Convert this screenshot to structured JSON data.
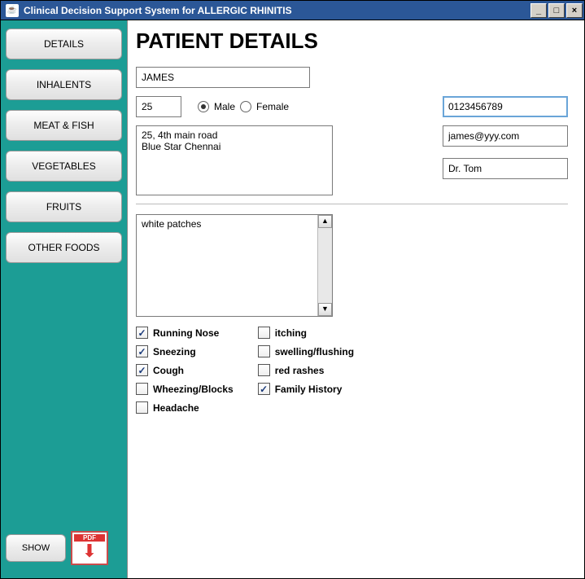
{
  "window": {
    "title": "Clinical Decision Support System for ALLERGIC RHINITIS"
  },
  "sidebar": {
    "items": [
      {
        "label": "DETAILS"
      },
      {
        "label": "INHALENTS"
      },
      {
        "label": "MEAT & FISH"
      },
      {
        "label": "VEGETABLES"
      },
      {
        "label": "FRUITS"
      },
      {
        "label": "OTHER FOODS"
      }
    ],
    "show_label": "SHOW",
    "pdf_label": "PDF"
  },
  "main": {
    "heading": "PATIENT DETAILS",
    "name": "JAMES",
    "age": "25",
    "gender": {
      "male_label": "Male",
      "female_label": "Female",
      "selected": "male"
    },
    "phone": "0123456789",
    "email": "james@yyy.com",
    "doctor": "Dr. Tom",
    "address": "25, 4th main road\nBlue Star Chennai",
    "notes": "white patches",
    "symptoms_col1": [
      {
        "label": "Running Nose",
        "checked": true
      },
      {
        "label": "Sneezing",
        "checked": true
      },
      {
        "label": "Cough",
        "checked": true
      },
      {
        "label": "Wheezing/Blocks",
        "checked": false
      },
      {
        "label": "Headache",
        "checked": false
      }
    ],
    "symptoms_col2": [
      {
        "label": "itching",
        "checked": false
      },
      {
        "label": "swelling/flushing",
        "checked": false
      },
      {
        "label": "red rashes",
        "checked": false
      },
      {
        "label": "Family History",
        "checked": true
      }
    ]
  }
}
